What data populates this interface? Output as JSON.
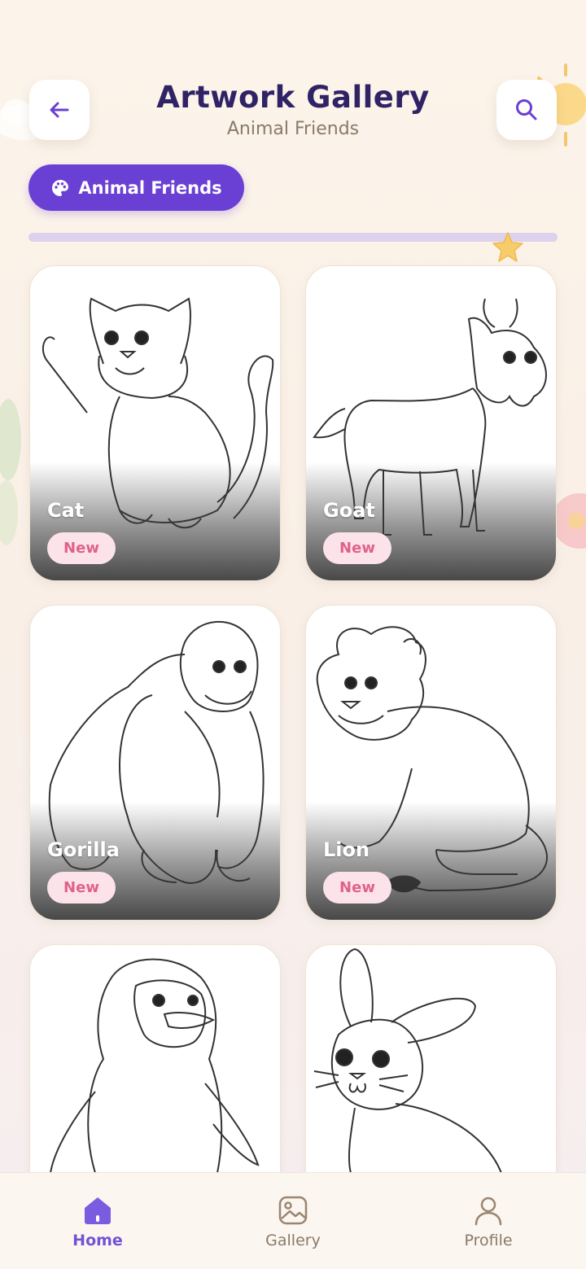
{
  "header": {
    "title": "Artwork Gallery",
    "subtitle": "Animal Friends",
    "back_icon": "arrow-left-icon",
    "search_icon": "search-icon"
  },
  "category_chip": {
    "label": "Animal Friends",
    "icon": "palette-icon"
  },
  "progress": {
    "fraction": 0.0
  },
  "cards": [
    {
      "name": "Cat",
      "badge": "New"
    },
    {
      "name": "Goat",
      "badge": "New"
    },
    {
      "name": "Gorilla",
      "badge": "New"
    },
    {
      "name": "Lion",
      "badge": "New"
    },
    {
      "name": "",
      "badge": ""
    },
    {
      "name": "",
      "badge": ""
    }
  ],
  "nav": [
    {
      "label": "Home",
      "icon": "home-icon",
      "active": true
    },
    {
      "label": "Gallery",
      "icon": "gallery-icon",
      "active": false
    },
    {
      "label": "Profile",
      "icon": "profile-icon",
      "active": false
    }
  ],
  "colors": {
    "accent": "#6a3fd3",
    "title": "#2f2366",
    "badge_bg": "#fce3ea",
    "badge_text": "#e0628c"
  }
}
